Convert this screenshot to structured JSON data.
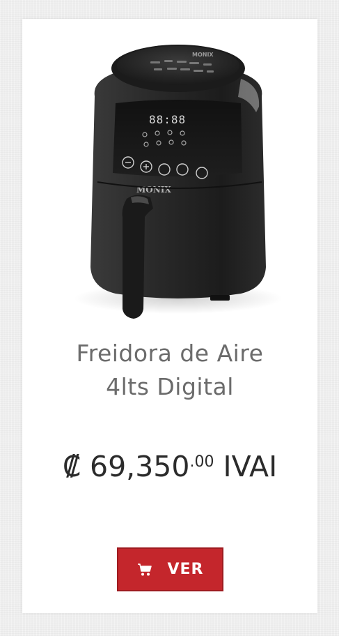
{
  "product": {
    "image_alt": "Freidora de Aire MONIX",
    "title_line1": "Freidora de Aire",
    "title_line2": "4lts Digital",
    "price": {
      "currency": "₡",
      "amount": "69,350",
      "decimals": ".00",
      "tax_suffix": "IVAI"
    },
    "brand_logo_text": "MONIX",
    "display_digits": "88:88",
    "view_button_label": "VER",
    "view_button_icon": "cart-icon"
  },
  "colors": {
    "button": "#c4262c",
    "title": "#6b6b6b",
    "price": "#2b2b2b"
  }
}
